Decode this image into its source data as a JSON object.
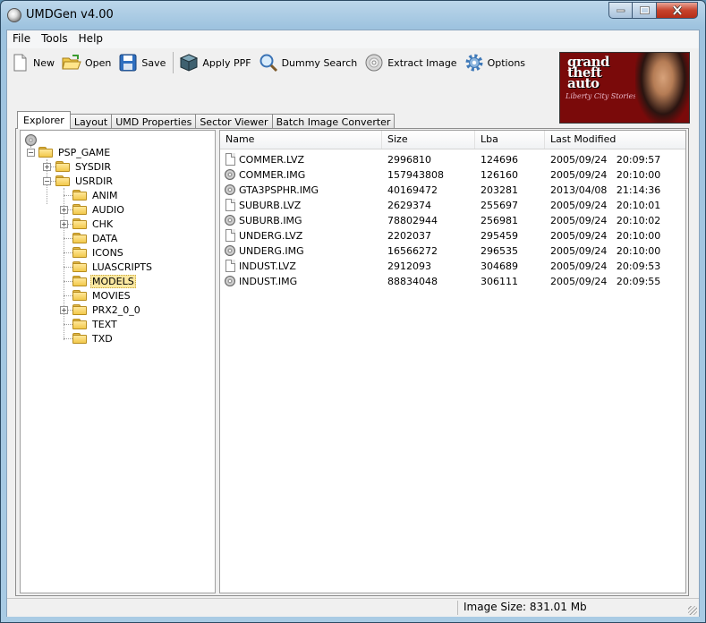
{
  "window": {
    "title": "UMDGen v4.00"
  },
  "menu": [
    "File",
    "Tools",
    "Help"
  ],
  "toolbar": {
    "new": "New",
    "open": "Open",
    "save": "Save",
    "apply_ppf": "Apply PPF",
    "dummy_search": "Dummy Search",
    "extract_image": "Extract Image",
    "options": "Options"
  },
  "banner": {
    "logo": "grand theft auto",
    "subtitle": "Liberty City Stories"
  },
  "tabs": [
    "Explorer",
    "Layout",
    "UMD Properties",
    "Sector Viewer",
    "Batch Image Converter"
  ],
  "active_tab": "Explorer",
  "tree": {
    "root": "PSP_GAME",
    "sysdir": "SYSDIR",
    "usrdir": "USRDIR",
    "usrdir_children": [
      "ANIM",
      "AUDIO",
      "CHK",
      "DATA",
      "ICONS",
      "LUASCRIPTS",
      "MODELS",
      "MOVIES",
      "PRX2_0_0",
      "TEXT",
      "TXD"
    ],
    "selected": "MODELS"
  },
  "list": {
    "columns": [
      "Name",
      "Size",
      "Lba",
      "Last Modified"
    ],
    "rows": [
      {
        "name": "COMMER.LVZ",
        "size": "2996810",
        "lba": "124696",
        "modified": "2005/09/24   20:09:57",
        "icon": "file-icon"
      },
      {
        "name": "COMMER.IMG",
        "size": "157943808",
        "lba": "126160",
        "modified": "2005/09/24   20:10:00",
        "icon": "disc-image-icon"
      },
      {
        "name": "GTA3PSPHR.IMG",
        "size": "40169472",
        "lba": "203281",
        "modified": "2013/04/08   21:14:36",
        "icon": "disc-image-icon"
      },
      {
        "name": "SUBURB.LVZ",
        "size": "2629374",
        "lba": "255697",
        "modified": "2005/09/24   20:10:01",
        "icon": "file-icon"
      },
      {
        "name": "SUBURB.IMG",
        "size": "78802944",
        "lba": "256981",
        "modified": "2005/09/24   20:10:02",
        "icon": "disc-image-icon"
      },
      {
        "name": "UNDERG.LVZ",
        "size": "2202037",
        "lba": "295459",
        "modified": "2005/09/24   20:10:00",
        "icon": "file-icon"
      },
      {
        "name": "UNDERG.IMG",
        "size": "16566272",
        "lba": "296535",
        "modified": "2005/09/24   20:10:00",
        "icon": "disc-image-icon"
      },
      {
        "name": "INDUST.LVZ",
        "size": "2912093",
        "lba": "304689",
        "modified": "2005/09/24   20:09:53",
        "icon": "file-icon"
      },
      {
        "name": "INDUST.IMG",
        "size": "88834048",
        "lba": "306111",
        "modified": "2005/09/24   20:09:55",
        "icon": "disc-image-icon"
      }
    ]
  },
  "status": {
    "image_size": "Image Size: 831.01 Mb"
  }
}
